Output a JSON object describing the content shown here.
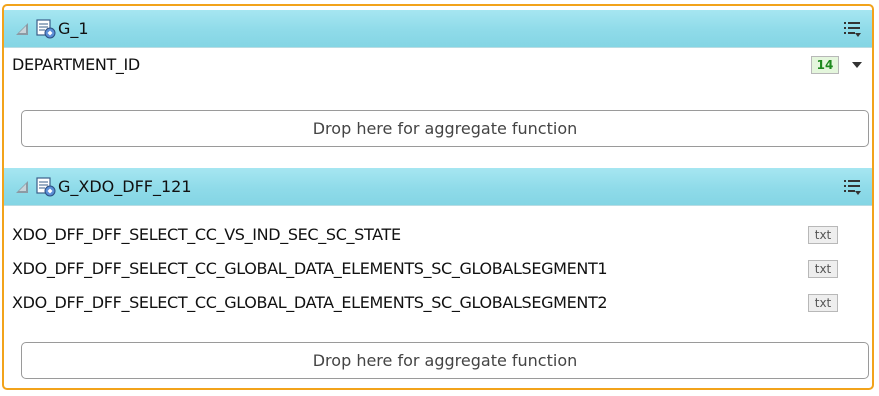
{
  "groups": [
    {
      "title": "G_1",
      "fields": [
        {
          "name": "DEPARTMENT_ID",
          "type_badge": "14",
          "type_icon": "number-type-icon"
        }
      ],
      "drop_zone_text": "Drop here for aggregate function"
    },
    {
      "title": "G_XDO_DFF_121",
      "fields": [
        {
          "name": "XDO_DFF_DFF_SELECT_CC_VS_IND_SEC_SC_STATE",
          "type_badge": "txt",
          "type_icon": "text-type-icon"
        },
        {
          "name": "XDO_DFF_DFF_SELECT_CC_GLOBAL_DATA_ELEMENTS_SC_GLOBALSEGMENT1",
          "type_badge": "txt",
          "type_icon": "text-type-icon"
        },
        {
          "name": "XDO_DFF_DFF_SELECT_CC_GLOBAL_DATA_ELEMENTS_SC_GLOBALSEGMENT2",
          "type_badge": "txt",
          "type_icon": "text-type-icon"
        }
      ],
      "drop_zone_text": "Drop here for aggregate function"
    }
  ],
  "icons": {
    "collapse": "collapse-triangle-icon",
    "group": "data-group-icon",
    "menu": "group-menu-icon",
    "dropdown": "chevron-down-icon"
  },
  "colors": {
    "outer_border": "#f2a31b",
    "group_header": "#8fdbe9",
    "number_badge": "#1e8a1e"
  }
}
